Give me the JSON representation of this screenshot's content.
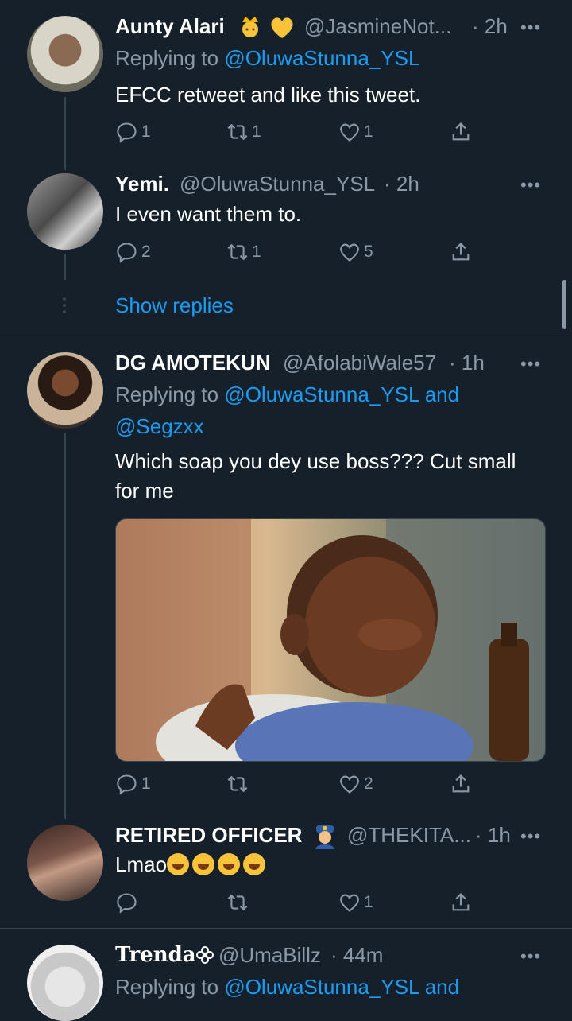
{
  "tweets": [
    {
      "name": "Aunty Alari",
      "badges": [
        "princess-emoji",
        "yellow-heart-emoji"
      ],
      "handle": "@JasmineNot...",
      "time": "· 2h",
      "replying_prefix": "Replying to",
      "replying_to": "@OluwaStunna_YSL",
      "text": "EFCC retweet and like this tweet.",
      "replies": "1",
      "retweets": "1",
      "likes": "1"
    },
    {
      "name": "Yemi.",
      "handle": "@OluwaStunna_YSL",
      "time": "· 2h",
      "text": "I even want them to.",
      "replies": "2",
      "retweets": "1",
      "likes": "5"
    },
    {
      "name": "DG AMOTEKUN",
      "handle": "@AfolabiWale57",
      "time": "· 1h",
      "replying_prefix": "Replying to",
      "replying_to": "@OluwaStunna_YSL",
      "replying_and": "and",
      "replying_to_2": "@Segzxx",
      "text_line1": "Which soap you dey use boss??? Cut small",
      "text_line2": "for me",
      "media": "gif-image",
      "replies": "1",
      "retweets": "",
      "likes": "2"
    },
    {
      "name": "RETIRED OFFICER",
      "badges": [
        "police-officer-emoji"
      ],
      "handle": "@THEKITA...",
      "time": "· 1h",
      "text": "Lmao",
      "emojis": [
        "laughing-emoji",
        "laughing-emoji",
        "laughing-emoji",
        "laughing-emoji"
      ],
      "replies": "",
      "retweets": "",
      "likes": "1"
    },
    {
      "name": "Trenda",
      "badges": [
        "flower-emoji"
      ],
      "handle": "@UmaBillz",
      "time": "· 44m",
      "replying_prefix": "Replying to",
      "replying_to": "@OluwaStunna_YSL",
      "replying_and": "and"
    }
  ],
  "show_replies": "Show replies",
  "more_glyph": "•••",
  "colors": {
    "background": "#15202b",
    "accent": "#1d9bf0",
    "muted": "#8b98a5",
    "divider": "#38444d"
  }
}
